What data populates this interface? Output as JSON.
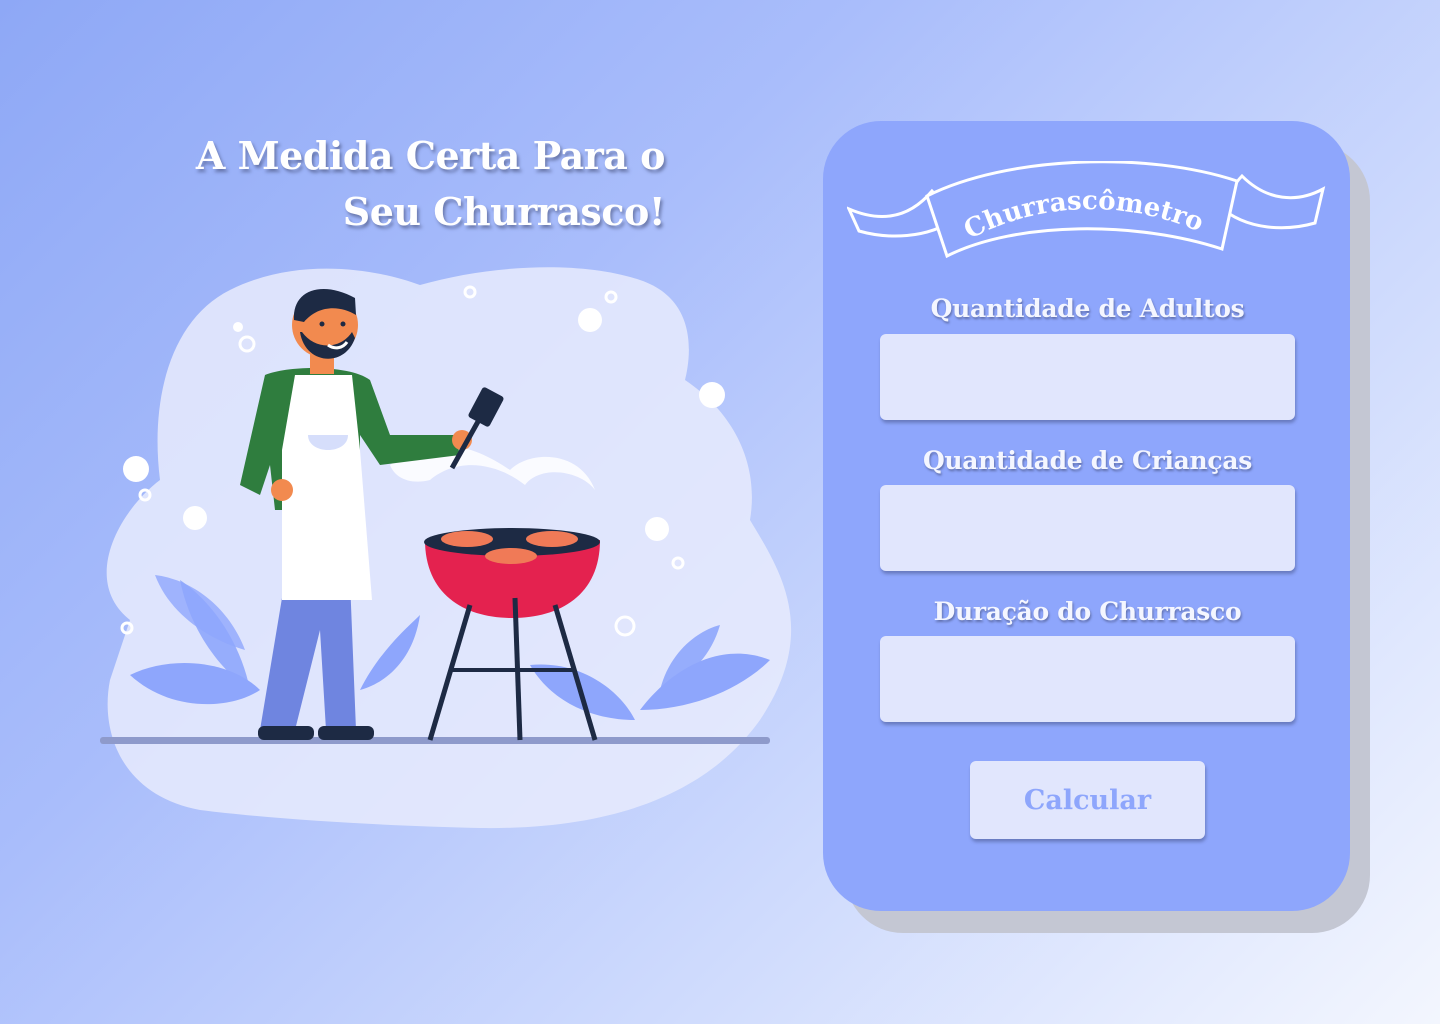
{
  "hero": {
    "title_line1": "A Medida Certa Para o",
    "title_line2": "Seu Churrasco!"
  },
  "calculator": {
    "banner_title": "Churrascômetro",
    "fields": [
      {
        "label": "Quantidade de Adultos",
        "value": "",
        "placeholder": ""
      },
      {
        "label": "Quantidade de Crianças",
        "value": "",
        "placeholder": ""
      },
      {
        "label": "Duração do Churrasco",
        "value": "",
        "placeholder": ""
      }
    ],
    "button_label": "Calcular"
  },
  "illustration": {
    "subject": "bbq-chef-illustration",
    "icons": [
      "person-icon",
      "spatula-icon",
      "grill-icon",
      "burger-patty-icon",
      "leaf-icon",
      "bubble-icon"
    ]
  },
  "colors": {
    "card_bg": "#8ea6fc",
    "card_shadow": "#c4c7d3",
    "input_bg": "#e1e6fd",
    "button_text": "#8ea6fc",
    "background_start": "#8ea8f6",
    "background_end": "#f3f6fe",
    "grill_red": "#e4224f",
    "shirt_green": "#2f7d3e"
  }
}
